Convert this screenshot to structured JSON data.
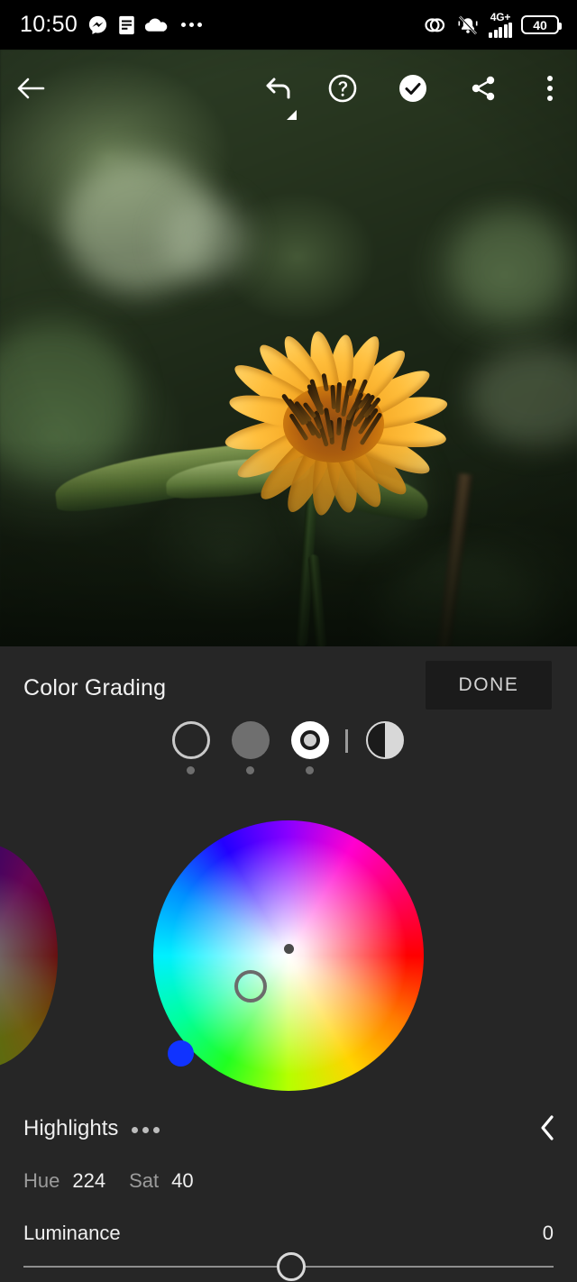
{
  "status_bar": {
    "time": "10:50",
    "left_icons": [
      "messenger-icon",
      "document-icon",
      "cloud-icon",
      "overflow-dots-icon"
    ],
    "network_label": "4G+",
    "battery_level": "40",
    "right_icons": [
      "loop-icon",
      "vibrate-off-icon",
      "signal-bars-icon",
      "battery-icon"
    ]
  },
  "toolbar": {
    "back_icon": "back-arrow-icon",
    "undo_icon": "undo-icon",
    "help_icon": "help-icon",
    "done_check_icon": "check-circle-icon",
    "share_icon": "share-icon",
    "more_icon": "more-vertical-icon"
  },
  "panel": {
    "title": "Color Grading",
    "done_label": "DONE",
    "tones": [
      {
        "name": "shadows",
        "icon": "outline-circle-icon",
        "selected": false
      },
      {
        "name": "midtones",
        "icon": "filled-gray-circle-icon",
        "selected": false
      },
      {
        "name": "highlights",
        "icon": "selected-ring-circle-icon",
        "selected": true
      },
      {
        "name": "global",
        "icon": "split-circle-icon",
        "selected": false
      }
    ],
    "color_wheel": {
      "handle_color": "#1033ff",
      "swatch_color": "#1033ff"
    },
    "section": {
      "label": "Highlights",
      "menu_icon": "ellipsis-icon",
      "collapse_icon": "chevron-left-icon"
    },
    "hue": {
      "label": "Hue",
      "value": "224"
    },
    "sat": {
      "label": "Sat",
      "value": "40"
    },
    "luminance": {
      "label": "Luminance",
      "value": "0"
    }
  }
}
